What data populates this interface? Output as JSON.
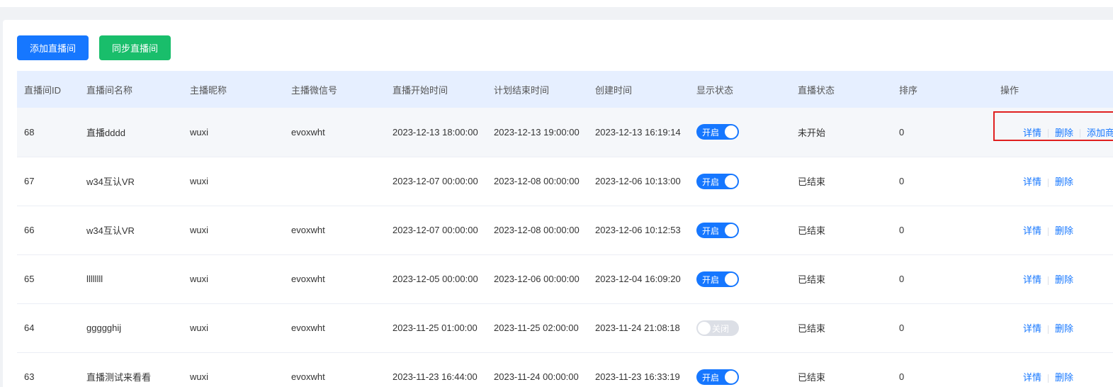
{
  "toolbar": {
    "add_label": "添加直播间",
    "sync_label": "同步直播间"
  },
  "columns": [
    "直播间ID",
    "直播间名称",
    "主播昵称",
    "主播微信号",
    "直播开始时间",
    "计划结束时间",
    "创建时间",
    "显示状态",
    "直播状态",
    "排序",
    "操作"
  ],
  "rows": [
    {
      "id": "68",
      "name": "直播dddd",
      "nick": "wuxi",
      "wechat": "evoxwht",
      "start": "2023-12-13 18:00:00",
      "end": "2023-12-13 19:00:00",
      "created": "2023-12-13 16:19:14",
      "display": "开启",
      "display_on": true,
      "status": "未开始",
      "sort": "0",
      "ops": [
        "详情",
        "删除",
        "添加商品"
      ]
    },
    {
      "id": "67",
      "name": "w34互认VR",
      "nick": "wuxi",
      "wechat": "",
      "start": "2023-12-07 00:00:00",
      "end": "2023-12-08 00:00:00",
      "created": "2023-12-06 10:13:00",
      "display": "开启",
      "display_on": true,
      "status": "已结束",
      "sort": "0",
      "ops": [
        "详情",
        "删除"
      ]
    },
    {
      "id": "66",
      "name": "w34互认VR",
      "nick": "wuxi",
      "wechat": "evoxwht",
      "start": "2023-12-07 00:00:00",
      "end": "2023-12-08 00:00:00",
      "created": "2023-12-06 10:12:53",
      "display": "开启",
      "display_on": true,
      "status": "已结束",
      "sort": "0",
      "ops": [
        "详情",
        "删除"
      ]
    },
    {
      "id": "65",
      "name": "llllllll",
      "nick": "wuxi",
      "wechat": "evoxwht",
      "start": "2023-12-05 00:00:00",
      "end": "2023-12-06 00:00:00",
      "created": "2023-12-04 16:09:20",
      "display": "开启",
      "display_on": true,
      "status": "已结束",
      "sort": "0",
      "ops": [
        "详情",
        "删除"
      ]
    },
    {
      "id": "64",
      "name": "ggggghij",
      "nick": "wuxi",
      "wechat": "evoxwht",
      "start": "2023-11-25 01:00:00",
      "end": "2023-11-25 02:00:00",
      "created": "2023-11-24 21:08:18",
      "display": "关闭",
      "display_on": false,
      "status": "已结束",
      "sort": "0",
      "ops": [
        "详情",
        "删除"
      ]
    },
    {
      "id": "63",
      "name": "直播测试来看看",
      "nick": "wuxi",
      "wechat": "evoxwht",
      "start": "2023-11-23 16:44:00",
      "end": "2023-11-24 00:00:00",
      "created": "2023-11-23 16:33:19",
      "display": "开启",
      "display_on": true,
      "status": "已结束",
      "sort": "0",
      "ops": [
        "详情",
        "删除"
      ]
    }
  ],
  "colors": {
    "primary": "#1677ff",
    "success": "#19be6b",
    "highlight": "#e02020",
    "header_bg": "#e6efff"
  }
}
